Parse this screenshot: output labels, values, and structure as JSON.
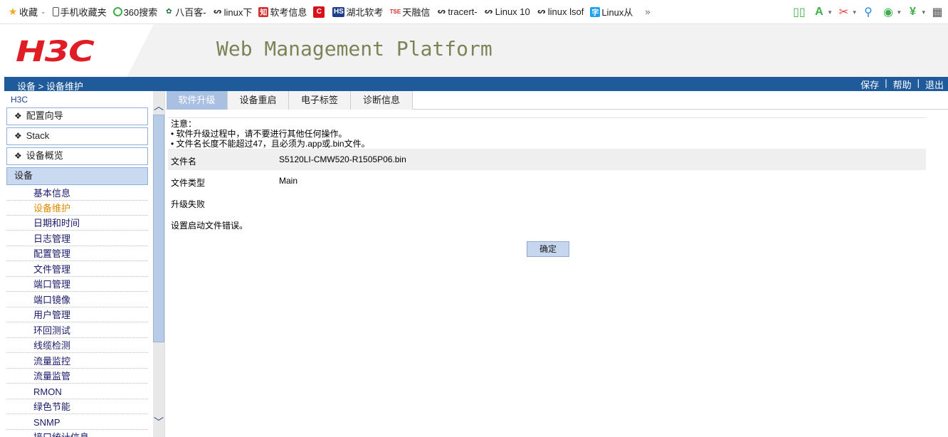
{
  "bookmarks": [
    {
      "label": "收藏",
      "icon": "star-icon"
    },
    {
      "label": "手机收藏夹",
      "icon": "phone-icon"
    },
    {
      "label": "360搜索",
      "icon": "search360-icon"
    },
    {
      "label": "八百客-",
      "icon": "800-icon"
    },
    {
      "label": "linux下",
      "icon": "linux-icon"
    },
    {
      "label": "软考信息",
      "icon": "exam-icon"
    },
    {
      "label": "",
      "icon": "c-logo-icon"
    },
    {
      "label": "湖北软考",
      "icon": "hs-icon"
    },
    {
      "label": "天融信",
      "icon": "topsec-icon"
    },
    {
      "label": "tracert-",
      "icon": "linux-icon"
    },
    {
      "label": "Linux 10",
      "icon": "linux-icon"
    },
    {
      "label": "linux lsof",
      "icon": "linux-icon"
    },
    {
      "label": "Linux从",
      "icon": "book-icon"
    },
    {
      "label": "»",
      "icon": ""
    }
  ],
  "header": {
    "logo": "H3C",
    "title": "Web Management Platform"
  },
  "navbar": {
    "breadcrumb": "设备 > 设备维护",
    "save": "保存",
    "help": "帮助",
    "logout": "退出",
    "sep": "|"
  },
  "sidebar": {
    "title": "H3C",
    "groups": [
      {
        "label": "配置向导"
      },
      {
        "label": "Stack"
      },
      {
        "label": "设备概览"
      },
      {
        "label": "设备"
      }
    ],
    "items": [
      {
        "label": "基本信息"
      },
      {
        "label": "设备维护"
      },
      {
        "label": "日期和时间"
      },
      {
        "label": "日志管理"
      },
      {
        "label": "配置管理"
      },
      {
        "label": "文件管理"
      },
      {
        "label": "端口管理"
      },
      {
        "label": "端口镜像"
      },
      {
        "label": "用户管理"
      },
      {
        "label": "环回测试"
      },
      {
        "label": "线缆检测"
      },
      {
        "label": "流量监控"
      },
      {
        "label": "流量监管"
      },
      {
        "label": "RMON"
      },
      {
        "label": "绿色节能"
      },
      {
        "label": "SNMP"
      },
      {
        "label": "接口统计信息"
      }
    ]
  },
  "tabs": [
    {
      "label": "软件升级"
    },
    {
      "label": "设备重启"
    },
    {
      "label": "电子标签"
    },
    {
      "label": "诊断信息"
    }
  ],
  "notice": {
    "title": "注意：",
    "line1": "•  软件升级过程中，请不要进行其他任何操作。",
    "line2": "•  文件名长度不能超过47，且必须为.app或.bin文件。"
  },
  "fields": {
    "file_name_label": "文件名",
    "file_name_value": "S5120LI-CMW520-R1505P06.bin",
    "file_type_label": "文件类型",
    "file_type_value": "Main",
    "status": "升级失败",
    "error": "设置启动文件错误。"
  },
  "ok_label": "确定"
}
